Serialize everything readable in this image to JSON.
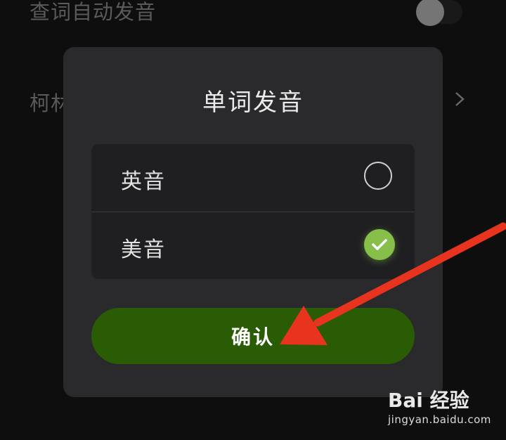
{
  "background": {
    "rows": [
      {
        "label": "查词自动发音",
        "toggle_on": false
      },
      {
        "label": "柯林"
      }
    ]
  },
  "dialog": {
    "title": "单词发音",
    "options": [
      {
        "label": "英音",
        "selected": false
      },
      {
        "label": "美音",
        "selected": true
      }
    ],
    "confirm_label": "确认"
  },
  "colors": {
    "accent": "#86c04a",
    "confirm_button": "#2a5c05",
    "annotation_arrow": "#e8331f"
  },
  "watermark": {
    "logo": "Bai 经验",
    "url": "jingyan.baidu.com"
  }
}
